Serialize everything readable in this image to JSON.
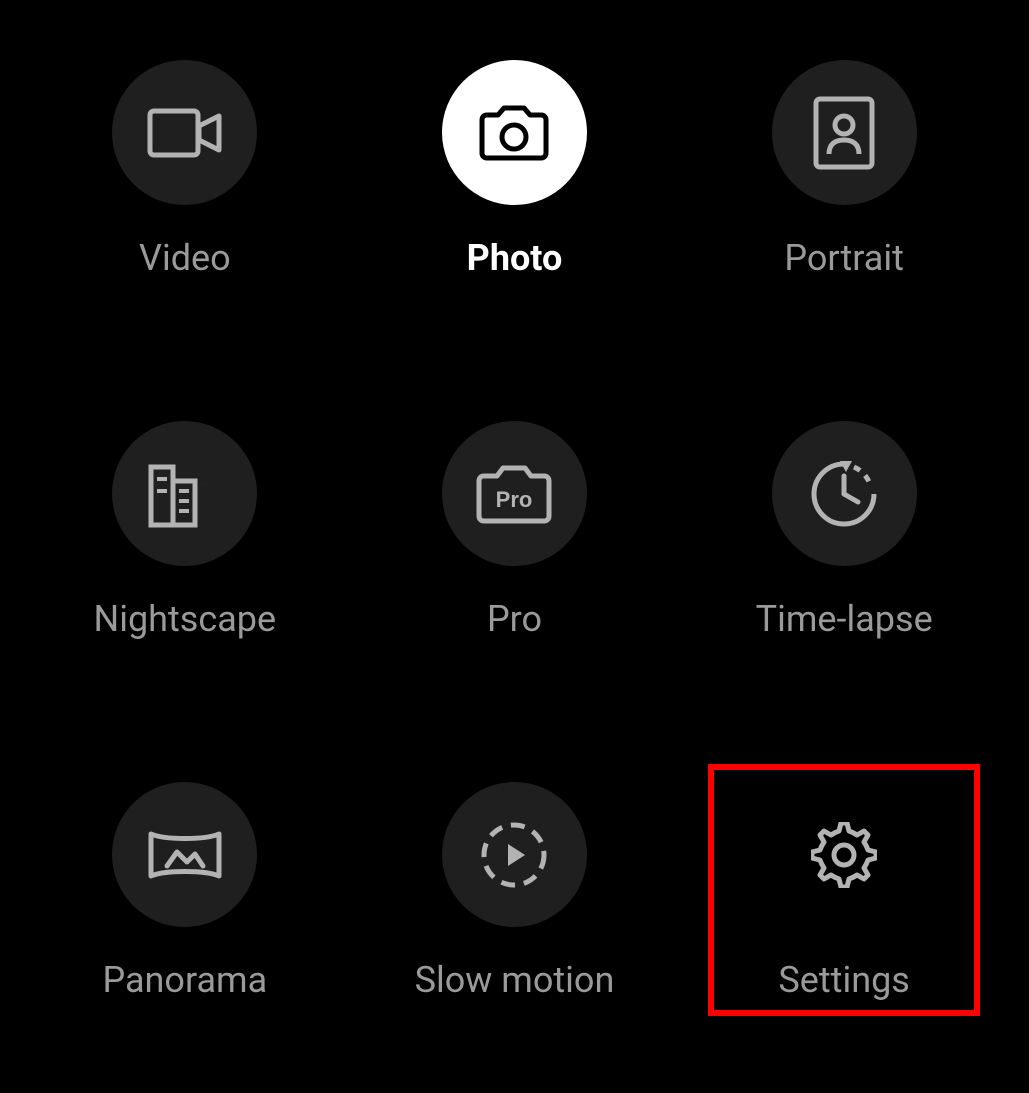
{
  "modes": [
    {
      "id": "video",
      "label": "Video",
      "icon": "video-icon",
      "active": false,
      "highlighted": false
    },
    {
      "id": "photo",
      "label": "Photo",
      "icon": "camera-icon",
      "active": true,
      "highlighted": false
    },
    {
      "id": "portrait",
      "label": "Portrait",
      "icon": "portrait-icon",
      "active": false,
      "highlighted": false
    },
    {
      "id": "nightscape",
      "label": "Nightscape",
      "icon": "nightscape-icon",
      "active": false,
      "highlighted": false
    },
    {
      "id": "pro",
      "label": "Pro",
      "icon": "pro-icon",
      "active": false,
      "highlighted": false
    },
    {
      "id": "time-lapse",
      "label": "Time-lapse",
      "icon": "timelapse-icon",
      "active": false,
      "highlighted": false
    },
    {
      "id": "panorama",
      "label": "Panorama",
      "icon": "panorama-icon",
      "active": false,
      "highlighted": false
    },
    {
      "id": "slow-motion",
      "label": "Slow motion",
      "icon": "slowmotion-icon",
      "active": false,
      "highlighted": false
    },
    {
      "id": "settings",
      "label": "Settings",
      "icon": "gear-icon",
      "active": false,
      "highlighted": true
    }
  ],
  "pro_text": "Pro",
  "colors": {
    "background": "#000000",
    "circle_inactive": "#1f1f1f",
    "circle_active": "#ffffff",
    "label_inactive": "#9a9a9a",
    "label_active": "#ffffff",
    "highlight": "#ff0000",
    "icon_stroke": "#b3b3b3",
    "icon_active": "#000000"
  }
}
